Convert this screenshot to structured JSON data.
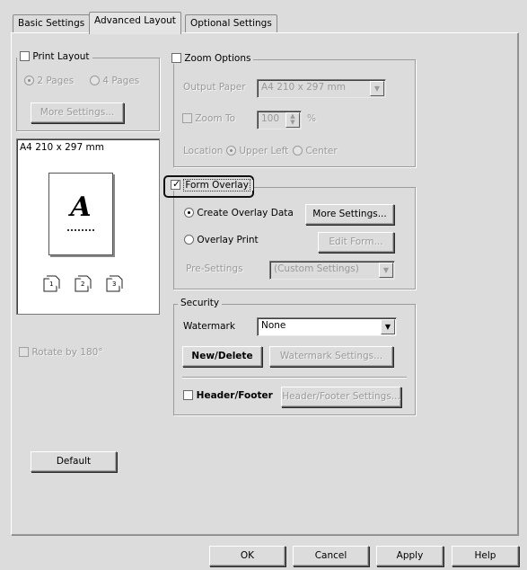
{
  "tabs": [
    "Basic Settings",
    "Advanced Layout",
    "Optional Settings"
  ],
  "print_layout": {
    "title": "Print Layout",
    "opt_2pages": "2 Pages",
    "opt_4pages": "4 Pages",
    "more_settings": "More Settings..."
  },
  "preview": {
    "paper": "A4 210 x 297 mm",
    "letter": "A",
    "page_nums": [
      "1",
      "2",
      "3"
    ]
  },
  "rotate": "Rotate by 180°",
  "default_button": "Default",
  "zoom": {
    "title": "Zoom Options",
    "output_paper_label": "Output Paper",
    "output_paper_value": "A4 210 x 297 mm",
    "zoom_to_label": "Zoom To",
    "zoom_value": "100",
    "percent": "%",
    "location_label": "Location",
    "upper_left": "Upper Left",
    "center": "Center"
  },
  "form_overlay": {
    "title": "Form Overlay",
    "create": "Create Overlay Data",
    "more_settings": "More Settings...",
    "overlay_print": "Overlay Print",
    "edit_form": "Edit Form...",
    "presettings_label": "Pre-Settings",
    "presettings_value": "(Custom Settings)"
  },
  "security": {
    "title": "Security",
    "watermark_label": "Watermark",
    "watermark_value": "None",
    "new_delete": "New/Delete",
    "watermark_settings": "Watermark Settings...",
    "header_footer": "Header/Footer",
    "header_footer_settings": "Header/Footer Settings..."
  },
  "footer": {
    "ok": "OK",
    "cancel": "Cancel",
    "apply": "Apply",
    "help": "Help"
  }
}
